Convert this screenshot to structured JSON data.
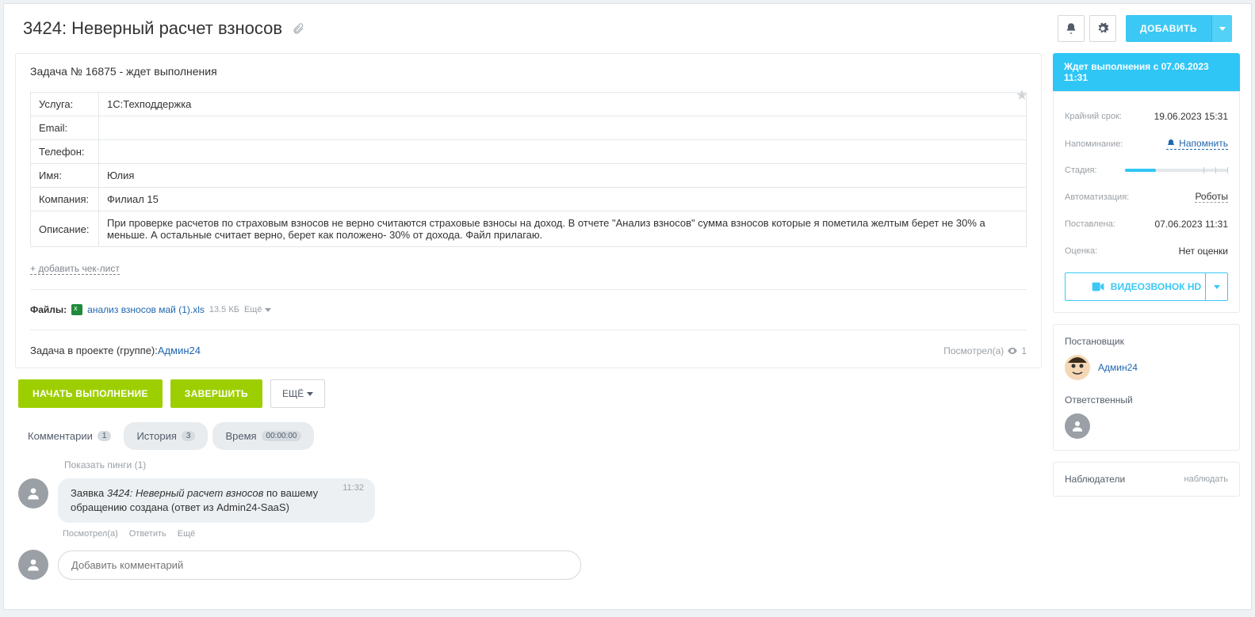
{
  "header": {
    "title": "3424: Неверный расчет взносов",
    "add_button": "ДОБАВИТЬ"
  },
  "task": {
    "subtitle": "Задача № 16875 - ждет выполнения",
    "labels": {
      "service": "Услуга:",
      "email": "Email:",
      "phone": "Телефон:",
      "name": "Имя:",
      "company": "Компания:",
      "description": "Описание:"
    },
    "values": {
      "service": "1С:Техподдержка",
      "email": "",
      "phone": "",
      "name": "Юлия",
      "company": "Филиал 15",
      "description": "При проверке расчетов по страховым взносов не верно считаются страховые взносы на доход. В отчете \"Анализ взносов\" сумма взносов которые я пометила желтым берет не 30% а меньше. А остальные считает верно, берет как положено- 30% от дохода. Файл прилагаю."
    },
    "add_checklist": "+ добавить чек-лист",
    "files_label": "Файлы:",
    "file_name": "анализ взносов май (1).xls",
    "file_size": "13.5 КБ",
    "file_more": "Ещё",
    "project_label": "Задача в проекте (группе): ",
    "project_link": "Админ24",
    "viewed_label": "Посмотрел(а)",
    "viewed_count": "1"
  },
  "actions": {
    "start": "НАЧАТЬ ВЫПОЛНЕНИЕ",
    "complete": "ЗАВЕРШИТЬ",
    "more": "ЕЩЁ"
  },
  "tabs": {
    "comments": "Комментарии",
    "comments_count": "1",
    "history": "История",
    "history_count": "3",
    "time": "Время",
    "time_value": "00:00:00"
  },
  "comments": {
    "show_pings": "Показать пинги (1)",
    "time": "11:32",
    "text_prefix": "Заявка ",
    "text_em": "3424: Неверный расчет взносов",
    "text_suffix": " по вашему обращению создана (ответ из Admin24-SaaS)",
    "meta_viewed": "Посмотрел(а)",
    "meta_reply": "Ответить",
    "meta_more": "Ещё",
    "placeholder": "Добавить комментарий"
  },
  "sidebar": {
    "status": "Ждет выполнения с 07.06.2023 11:31",
    "deadline_label": "Крайний срок:",
    "deadline_value": "19.06.2023 15:31",
    "remind_label": "Напоминание:",
    "remind_link": "Напомнить",
    "stage_label": "Стадия:",
    "automation_label": "Автоматизация:",
    "automation_link": "Роботы",
    "created_label": "Поставлена:",
    "created_value": "07.06.2023 11:31",
    "rating_label": "Оценка:",
    "rating_value": "Нет оценки",
    "videocall": "ВИДЕОЗВОНОК HD",
    "poster_heading": "Постановщик",
    "poster_name": "Админ24",
    "responsible_heading": "Ответственный",
    "watchers_heading": "Наблюдатели",
    "watch_link": "наблюдать"
  }
}
